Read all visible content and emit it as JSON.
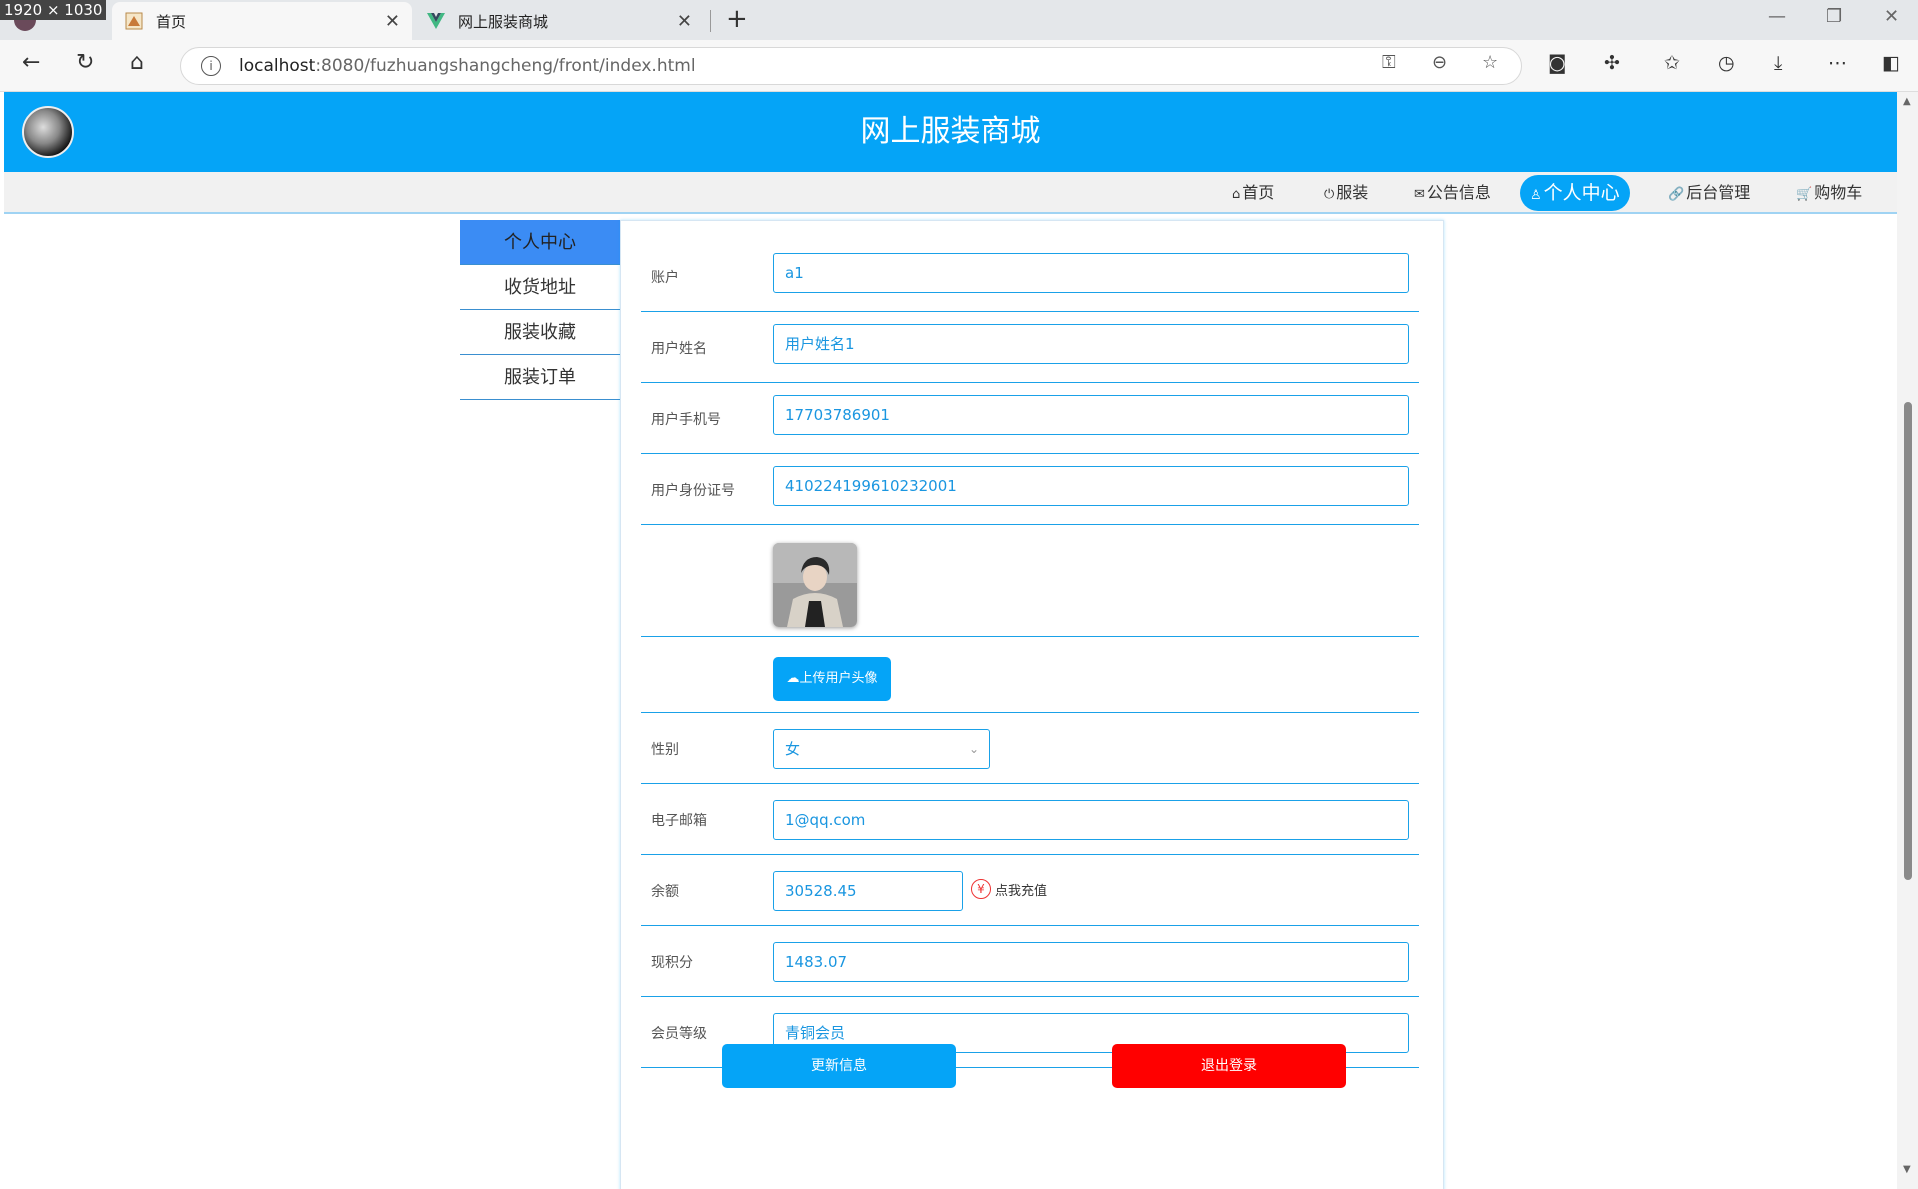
{
  "browser": {
    "resolution_badge": "1920 × 1030",
    "tabs": [
      {
        "title": "首页"
      },
      {
        "title": "网上服装商城"
      }
    ],
    "url_host": "localhost",
    "url_rest": ":8080/fuzhuangshangcheng/front/index.html"
  },
  "site": {
    "title": "网上服装商城",
    "menu": [
      {
        "icon": "⌂",
        "label": "首页"
      },
      {
        "icon": "⏻",
        "label": "服装"
      },
      {
        "icon": "✉",
        "label": "公告信息"
      },
      {
        "icon": "♙",
        "label": "个人中心"
      },
      {
        "icon": "🔗",
        "label": "后台管理"
      },
      {
        "icon": "🛒",
        "label": "购物车"
      }
    ],
    "active_menu": "个人中心"
  },
  "sidebar": {
    "items": [
      {
        "label": "个人中心"
      },
      {
        "label": "收货地址"
      },
      {
        "label": "服装收藏"
      },
      {
        "label": "服装订单"
      }
    ]
  },
  "form": {
    "account_label": "账户",
    "account_value": "a1",
    "name_label": "用户姓名",
    "name_value": "用户姓名1",
    "phone_label": "用户手机号",
    "phone_value": "17703786901",
    "idcard_label": "用户身份证号",
    "idcard_value": "410224199610232001",
    "upload_label": "上传用户头像",
    "gender_label": "性别",
    "gender_value": "女",
    "email_label": "电子邮箱",
    "email_value": "1@qq.com",
    "balance_label": "余额",
    "balance_value": "30528.45",
    "recharge_symbol": "¥",
    "recharge_label": "点我充值",
    "points_label": "现积分",
    "points_value": "1483.07",
    "level_label": "会员等级",
    "level_value": "青铜会员",
    "update_label": "更新信息",
    "logout_label": "退出登录"
  },
  "colors": {
    "primary": "#05a4f7",
    "sidebar_active": "#3b8cf4",
    "logout": "#ff0000"
  }
}
